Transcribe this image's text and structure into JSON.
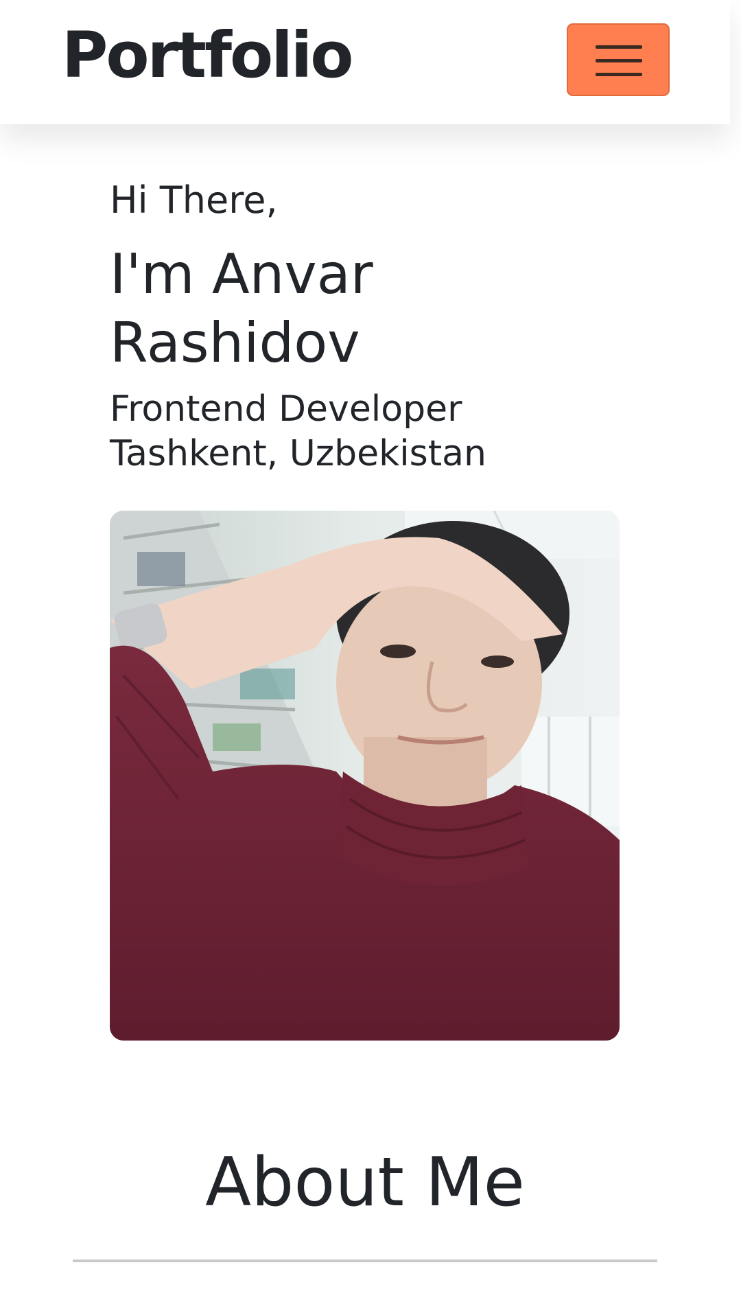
{
  "navbar": {
    "brand": "Portfolio",
    "toggle_icon": "hamburger-menu-icon",
    "toggle_color": "#ff7f50"
  },
  "hero": {
    "greeting": "Hi There,",
    "name": "I'm Anvar Rashidov",
    "role": "Frontend Developer",
    "location": "Tashkent, Uzbekistan"
  },
  "about": {
    "title": "About Me"
  }
}
